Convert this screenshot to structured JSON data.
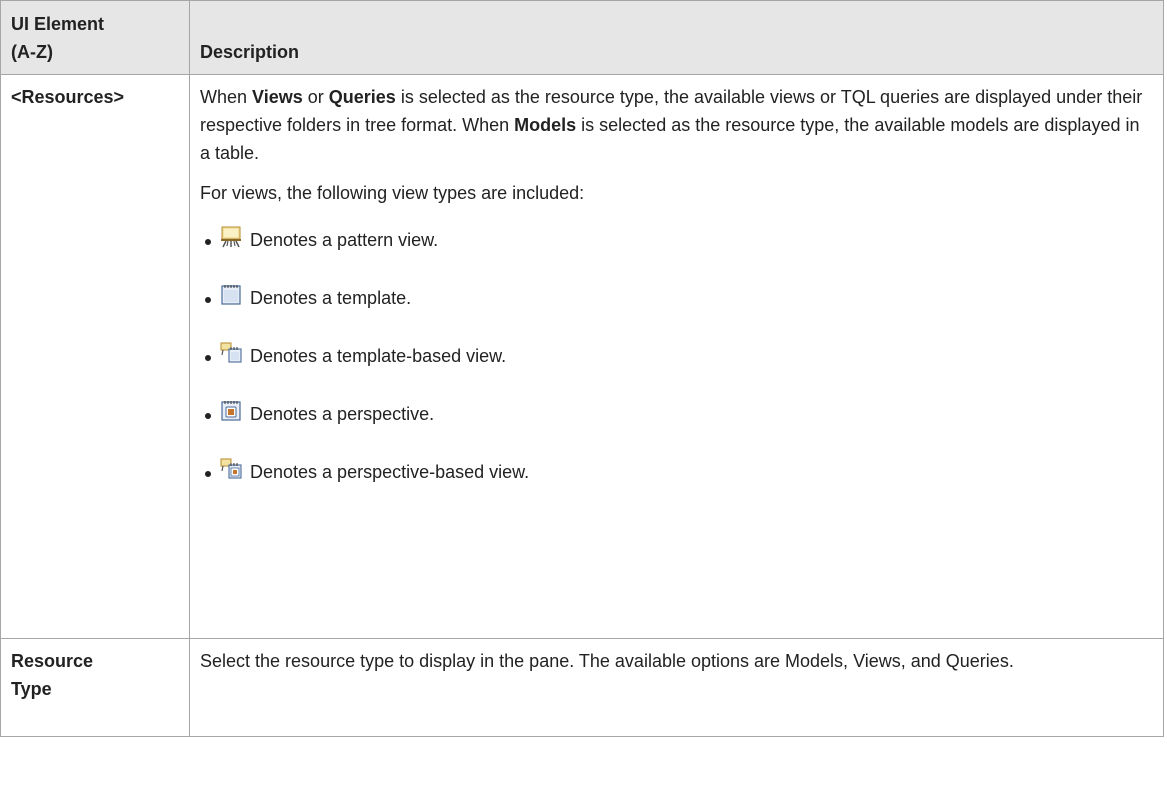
{
  "table": {
    "header": {
      "col1_line1": "UI Element",
      "col1_line2": "(A-Z)",
      "col2": "Description"
    },
    "rows": [
      {
        "element": "<Resources>",
        "paragraph1": {
          "t1": "When ",
          "b1": "Views",
          "t2": " or ",
          "b2": "Queries",
          "t3": " is selected as the resource type, the available views or TQL queries are displayed under their respective folders in tree format. When ",
          "b3": "Models",
          "t4": " is selected as the resource type, the available models are displayed in a table."
        },
        "paragraph2": "For views, the following view types are included:",
        "view_types": [
          {
            "icon": "pattern-view-icon",
            "text": "Denotes a pattern view."
          },
          {
            "icon": "template-icon",
            "text": "Denotes a template."
          },
          {
            "icon": "template-based-view-icon",
            "text": "Denotes a template-based view."
          },
          {
            "icon": "perspective-icon",
            "text": "Denotes a perspective."
          },
          {
            "icon": "perspective-based-view-icon",
            "text": "Denotes a perspective-based view."
          }
        ]
      },
      {
        "element_line1": "Resource",
        "element_line2": "Type",
        "description": "Select the resource type to display in the pane. The available options are Models, Views, and Queries."
      }
    ]
  }
}
